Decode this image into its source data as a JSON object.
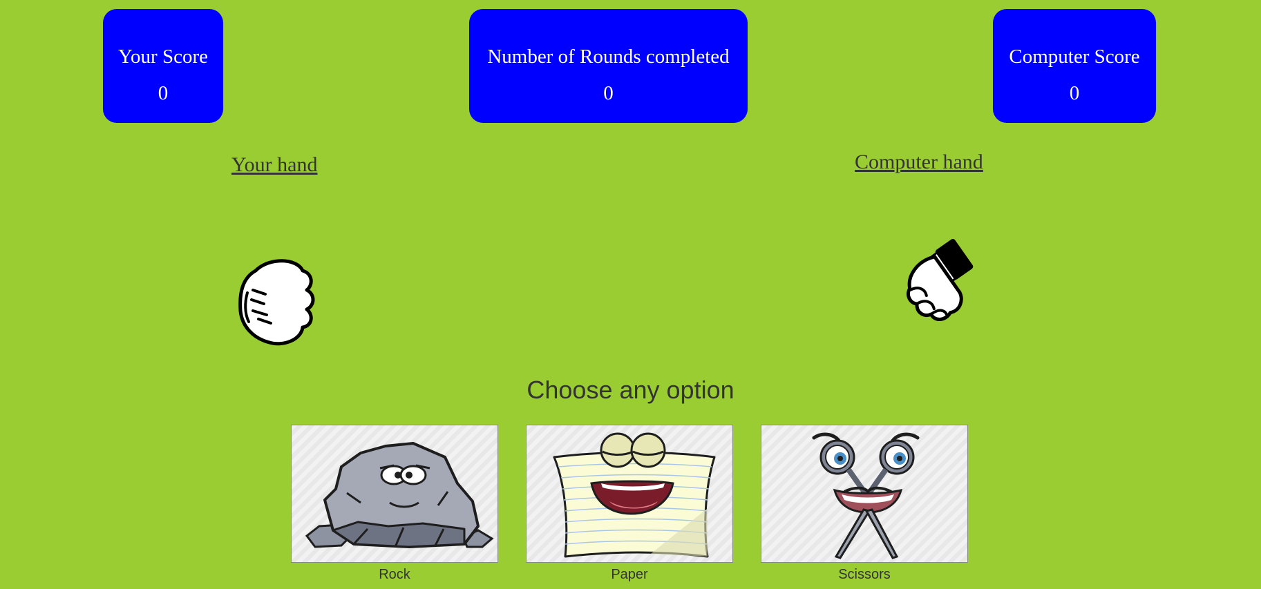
{
  "scoreboard": {
    "your_score_label": "Your Score",
    "your_score_value": "0",
    "rounds_label": "Number of Rounds completed",
    "rounds_value": "0",
    "computer_score_label": "Computer Score",
    "computer_score_value": "0"
  },
  "hands": {
    "your_hand_label": "Your hand",
    "computer_hand_label": "Computer hand",
    "your_hand_icon": "fist-icon",
    "computer_hand_icon": "fist-icon"
  },
  "choices": {
    "title": "Choose any option",
    "options": [
      {
        "label": "Rock",
        "icon": "rock-icon"
      },
      {
        "label": "Paper",
        "icon": "paper-icon"
      },
      {
        "label": "Scissors",
        "icon": "scissors-icon"
      }
    ]
  },
  "colors": {
    "background": "#9acd32",
    "score_box": "#0000ff",
    "score_text": "#ffffff",
    "label_text": "#333333"
  }
}
